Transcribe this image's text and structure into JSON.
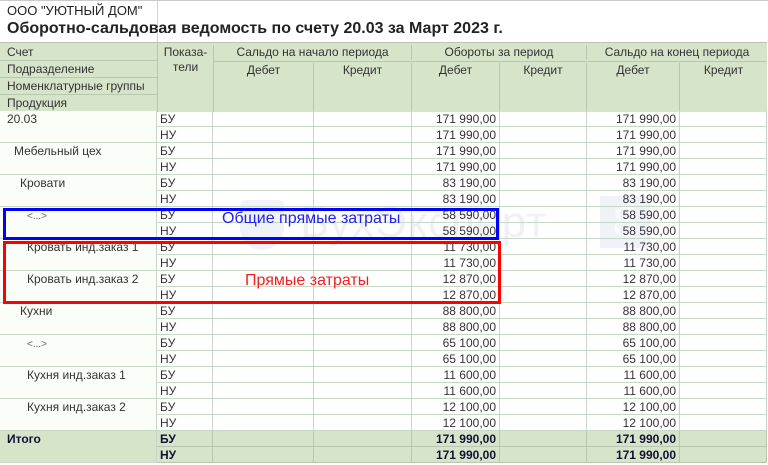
{
  "header": {
    "company": "ООО \"УЮТНЫЙ ДОМ\"",
    "title": "Оборотно-сальдовая ведомость по счету 20.03 за Март 2023 г."
  },
  "columns": {
    "left": [
      "Счет",
      "Подразделение",
      "Номенклатурные группы",
      "Продукция"
    ],
    "indicators": "Показа-\nтели",
    "opening": "Сальдо на начало периода",
    "turnover": "Обороты за период",
    "closing": "Сальдо на конец периода",
    "debit": "Дебет",
    "credit": "Кредит"
  },
  "rows": [
    {
      "name": "20.03",
      "level": 0,
      "bu": "171 990,00",
      "nu": "171 990,00"
    },
    {
      "name": "Мебельный цех",
      "level": 1,
      "bu": "171 990,00",
      "nu": "171 990,00"
    },
    {
      "name": "Кровати",
      "level": 2,
      "bu": "83 190,00",
      "nu": "83 190,00"
    },
    {
      "name": "<...>",
      "level": 3,
      "bu": "58 590,00",
      "nu": "58 590,00"
    },
    {
      "name": "Кровать инд.заказ 1",
      "level": 3,
      "bu": "11 730,00",
      "nu": "11 730,00"
    },
    {
      "name": "Кровать инд.заказ 2",
      "level": 3,
      "bu": "12 870,00",
      "nu": "12 870,00"
    },
    {
      "name": "Кухни",
      "level": 2,
      "bu": "88 800,00",
      "nu": "88 800,00"
    },
    {
      "name": "<...>",
      "level": 3,
      "bu": "65 100,00",
      "nu": "65 100,00"
    },
    {
      "name": "Кухня инд.заказ 1",
      "level": 3,
      "bu": "11 600,00",
      "nu": "11 600,00"
    },
    {
      "name": "Кухня инд.заказ 2",
      "level": 3,
      "bu": "12 100,00",
      "nu": "12 100,00"
    }
  ],
  "total": {
    "name": "Итого",
    "bu": "171 990,00",
    "nu": "171 990,00"
  },
  "indicator_labels": {
    "bu": "БУ",
    "nu": "НУ"
  },
  "annotations": {
    "blue": "Общие прямые затраты",
    "red": "Прямые затраты",
    "blue_color": "#0000ff",
    "red_color": "#ff0000"
  },
  "watermark": {
    "text": "БухЭксперт",
    "digit": "8"
  }
}
